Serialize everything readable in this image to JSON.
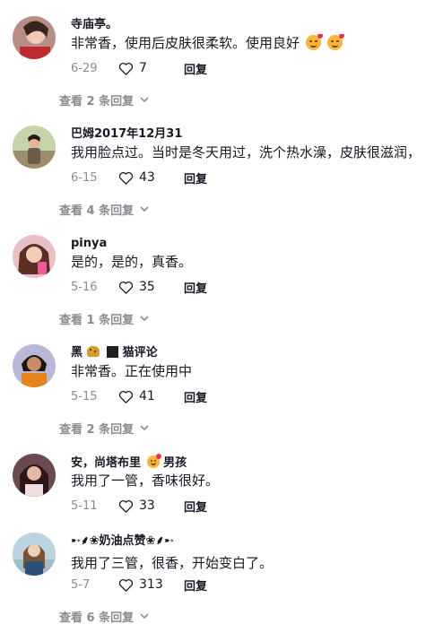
{
  "comments": [
    {
      "username": "寺庙亭。",
      "text": "非常香，使用后皮肤很柔软。使用良好",
      "emoji_after_text": [
        "smiling-face-with-hearts-icon",
        "smiling-face-with-hearts-icon"
      ],
      "date": "6-29",
      "likes": "7",
      "reply_label": "回复",
      "view_replies": "查看 2 条回复"
    },
    {
      "username": "巴姆2017年12月31",
      "text": "我用脸点过。当时是冬天用过，洗个热水澡，皮肤很滋润，",
      "date": "6-15",
      "likes": "43",
      "reply_label": "回复",
      "view_replies": "查看 4 条回复"
    },
    {
      "username": "pinya",
      "text": "是的，是的，真香。",
      "date": "5-16",
      "likes": "35",
      "reply_label": "回复",
      "view_replies": "查看 1 条回复"
    },
    {
      "username_prefix": "黑",
      "username_suffix": "猫评论",
      "username_icons": [
        "leopard-icon",
        "black-square-icon"
      ],
      "text": "非常香。正在使用中",
      "date": "5-15",
      "likes": "41",
      "reply_label": "回复",
      "view_replies": "查看 2 条回复"
    },
    {
      "username_prefix": "安，尚塔布里",
      "username_suffix": "男孩",
      "username_icons": [
        "smiling-face-with-hearts-icon"
      ],
      "text": "我用了一管，香味很好。",
      "date": "5-11",
      "likes": "33",
      "reply_label": "回复"
    },
    {
      "username": "➸⸙❀奶油点赞❀⸙➸",
      "text": "我用了三管，很香，开始变白了。",
      "date": "5-7",
      "likes": "313",
      "reply_label": "回复",
      "view_replies": "查看 6 条回复"
    }
  ],
  "colors": {
    "text": "#161823",
    "secondary": "#8a8b91",
    "background": "#ffffff"
  }
}
